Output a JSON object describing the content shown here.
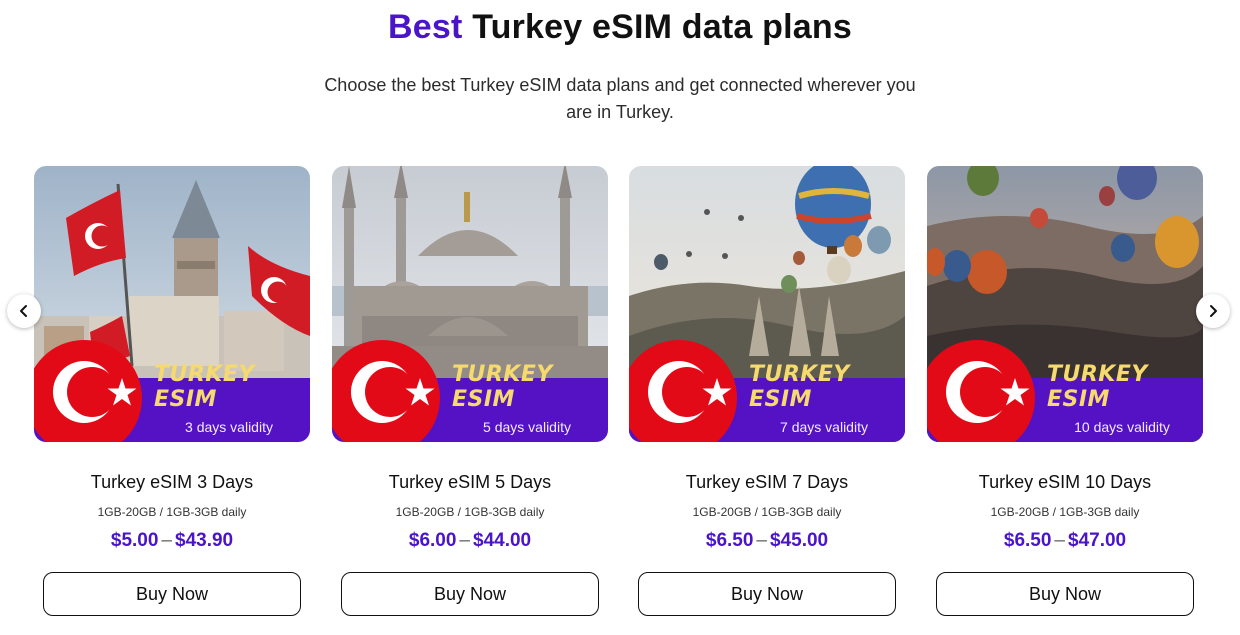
{
  "section": {
    "heading_accent": "Best",
    "heading_rest": "Turkey eSIM data plans",
    "subtitle": "Choose the best Turkey eSIM data plans and get connected wherever you are in Turkey."
  },
  "carousel": {
    "prev_icon": "chevron-left-icon",
    "next_icon": "chevron-right-icon"
  },
  "colors": {
    "accent": "#4a14c8",
    "banner": "#5512c4",
    "flag_red": "#e30a17",
    "banner_title": "#f6d96f"
  },
  "plans": [
    {
      "image_title": "TURKEY ESIM",
      "image_validity": "3 days validity",
      "name": "Turkey eSIM 3 Days",
      "data": "1GB-20GB / 1GB-3GB daily",
      "price_min": "$5.00",
      "price_sep": "–",
      "price_max": "$43.90",
      "button": "Buy Now"
    },
    {
      "image_title": "TURKEY ESIM",
      "image_validity": "5 days validity",
      "name": "Turkey eSIM 5 Days",
      "data": "1GB-20GB / 1GB-3GB daily",
      "price_min": "$6.00",
      "price_sep": "–",
      "price_max": "$44.00",
      "button": "Buy Now"
    },
    {
      "image_title": "TURKEY ESIM",
      "image_validity": "7 days validity",
      "name": "Turkey eSIM 7 Days",
      "data": "1GB-20GB / 1GB-3GB daily",
      "price_min": "$6.50",
      "price_sep": "–",
      "price_max": "$45.00",
      "button": "Buy Now"
    },
    {
      "image_title": "TURKEY ESIM",
      "image_validity": "10 days validity",
      "name": "Turkey eSIM 10 Days",
      "data": "1GB-20GB / 1GB-3GB daily",
      "price_min": "$6.50",
      "price_sep": "–",
      "price_max": "$47.00",
      "button": "Buy Now"
    }
  ]
}
